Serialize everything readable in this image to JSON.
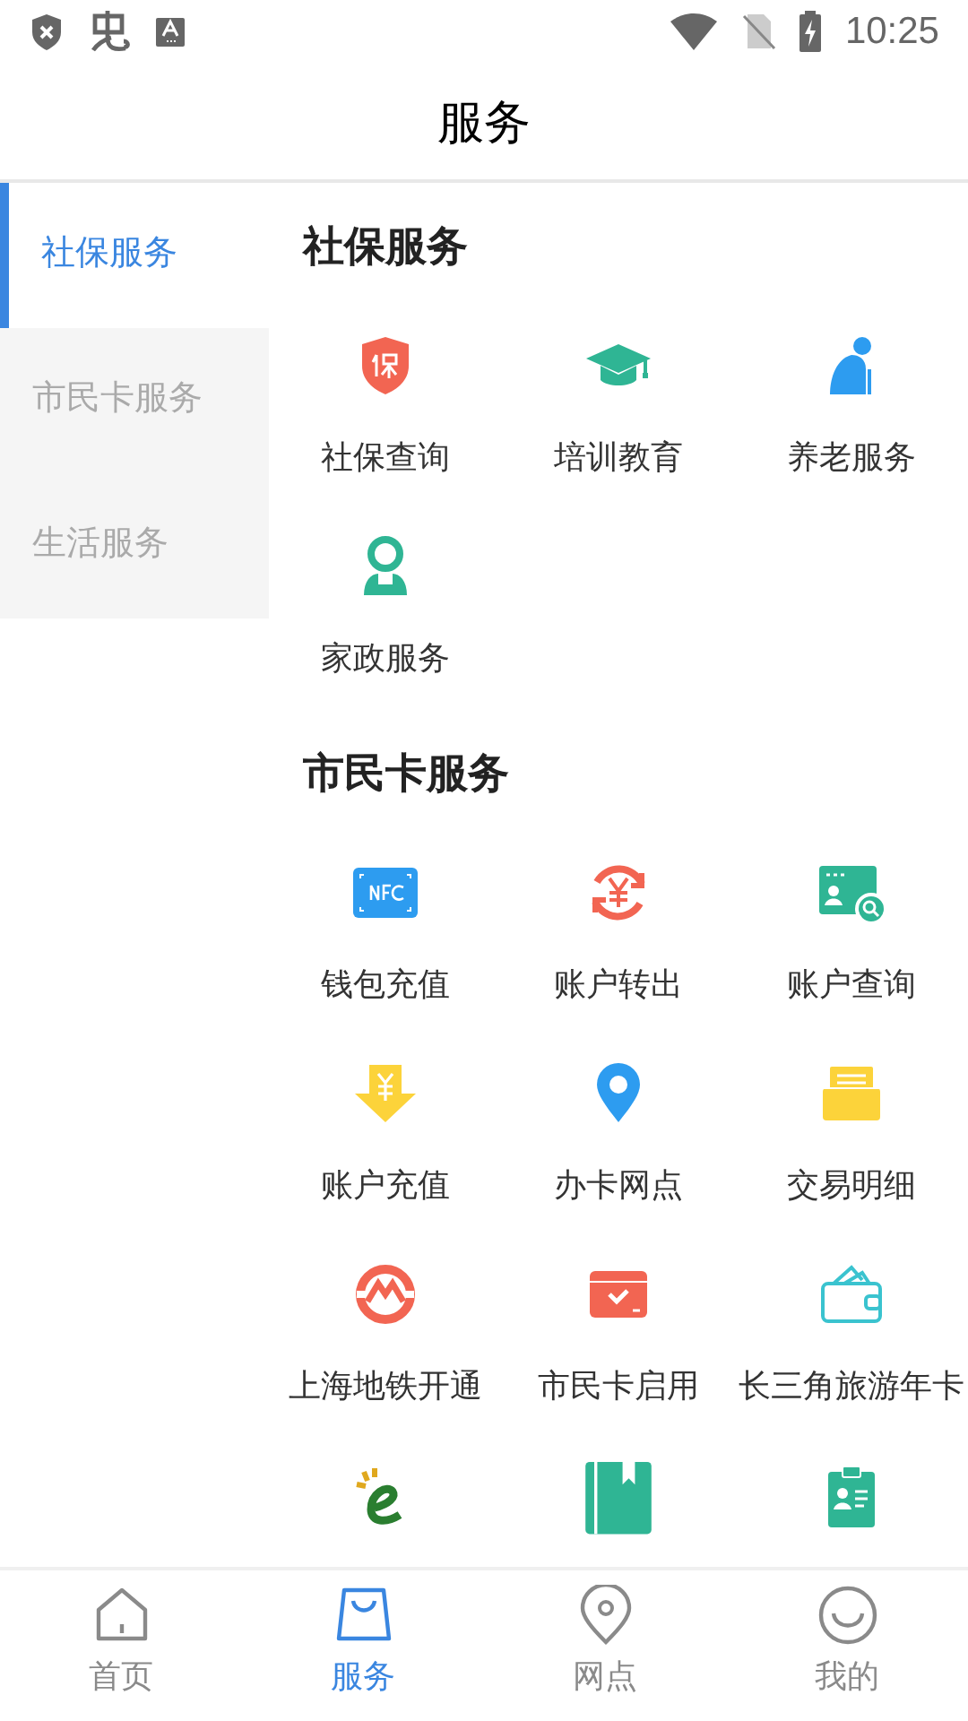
{
  "status_bar": {
    "time": "10:25"
  },
  "header": {
    "title": "服务"
  },
  "sidebar": {
    "items": [
      {
        "label": "社保服务",
        "selected": true
      },
      {
        "label": "市民卡服务",
        "selected": false
      },
      {
        "label": "生活服务",
        "selected": false
      }
    ]
  },
  "sections": [
    {
      "title": "社保服务",
      "items": [
        {
          "kind": "labeled",
          "label": "社保查询"
        },
        {
          "kind": "labeled",
          "label": "培训教育"
        },
        {
          "kind": "labeled",
          "label": "养老服务"
        },
        {
          "kind": "labeled",
          "label": "家政服务"
        }
      ]
    },
    {
      "title": "市民卡服务",
      "items": [
        {
          "kind": "labeled",
          "label": "钱包充值"
        },
        {
          "kind": "labeled",
          "label": "账户转出"
        },
        {
          "kind": "labeled",
          "label": "账户查询"
        },
        {
          "kind": "labeled",
          "label": "账户充值"
        },
        {
          "kind": "labeled",
          "label": "办卡网点"
        },
        {
          "kind": "labeled",
          "label": "交易明细"
        },
        {
          "kind": "labeled",
          "label": "上海地铁开通"
        },
        {
          "kind": "labeled",
          "label": "市民卡启用"
        },
        {
          "kind": "labeled",
          "label": "长三角旅游年卡"
        },
        {
          "kind": "icon_only"
        },
        {
          "kind": "icon_only"
        },
        {
          "kind": "icon_only"
        }
      ]
    }
  ],
  "bottom_nav": {
    "items": [
      {
        "label": "首页",
        "selected": false
      },
      {
        "label": "服务",
        "selected": true
      },
      {
        "label": "网点",
        "selected": false
      },
      {
        "label": "我的",
        "selected": false
      }
    ]
  }
}
